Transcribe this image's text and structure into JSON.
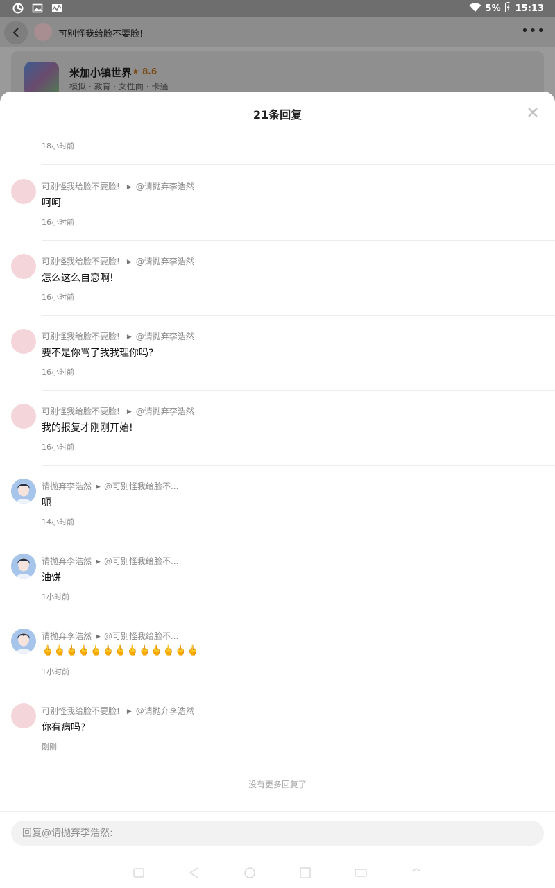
{
  "status_bar": {
    "battery": "5%",
    "time": "15:13",
    "icons": [
      "sync-icon",
      "image-icon",
      "activity-icon",
      "wifi-icon",
      "battery-charging-icon"
    ]
  },
  "background": {
    "header_title": "可别怪我给脸不要脸!",
    "app_name": "米加小镇世界",
    "app_rating": "8.6",
    "app_tags": "模拟 · 教育 · 女性向 · 卡通"
  },
  "sheet": {
    "title": "21条回复",
    "first_time": "18小时前",
    "replies": [
      {
        "author": "可别怪我给脸不要脸!",
        "target": "@请抛弃李浩然",
        "content": "呵呵",
        "time": "16小时前",
        "avatar": "pink"
      },
      {
        "author": "可别怪我给脸不要脸!",
        "target": "@请抛弃李浩然",
        "content": "怎么这么自恋啊!",
        "time": "16小时前",
        "avatar": "pink"
      },
      {
        "author": "可别怪我给脸不要脸!",
        "target": "@请抛弃李浩然",
        "content": "要不是你骂了我我理你吗?",
        "time": "16小时前",
        "avatar": "pink"
      },
      {
        "author": "可别怪我给脸不要脸!",
        "target": "@请抛弃李浩然",
        "content": "我的报复才刚刚开始!",
        "time": "16小时前",
        "avatar": "pink"
      },
      {
        "author": "请抛弃李浩然",
        "target": "@可别怪我给脸不...",
        "content": "呃",
        "time": "14小时前",
        "avatar": "person"
      },
      {
        "author": "请抛弃李浩然",
        "target": "@可别怪我给脸不...",
        "content": "油饼",
        "time": "1小时前",
        "avatar": "person"
      },
      {
        "author": "请抛弃李浩然",
        "target": "@可别怪我给脸不...",
        "content": "🖕🖕🖕🖕🖕🖕🖕🖕🖕🖕🖕🖕🖕",
        "time": "1小时前",
        "avatar": "person"
      },
      {
        "author": "可别怪我给脸不要脸!",
        "target": "@请抛弃李浩然",
        "content": "你有病吗?",
        "time": "刚刚",
        "avatar": "pink"
      }
    ],
    "no_more": "没有更多回复了",
    "reply_placeholder": "回复@请抛弃李浩然:"
  },
  "colors": {
    "sheet_bg": "#ffffff",
    "scrim": "#9a9a9a",
    "meta_text": "#8a8a8a",
    "rating": "#e8930c"
  }
}
